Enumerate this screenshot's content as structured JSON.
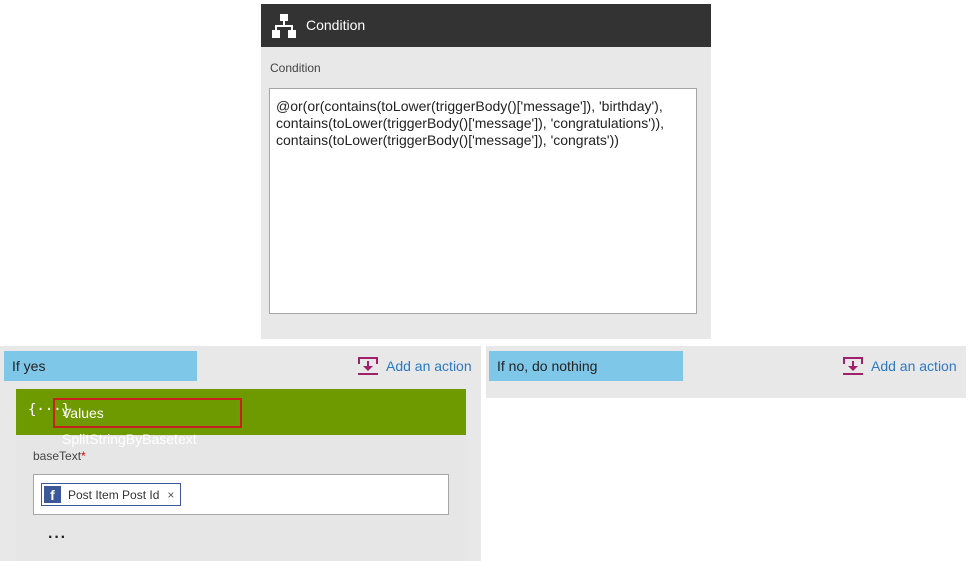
{
  "condition": {
    "header_title": "Condition",
    "field_label": "Condition",
    "expression_lines": [
      "@or(or(contains(toLower(triggerBody()['message']), 'birthday'),",
      "contains(toLower(triggerBody()['message']), 'congratulations')),",
      "contains(toLower(triggerBody()['message']), 'congrats'))"
    ]
  },
  "yes_branch": {
    "label": "If yes",
    "add_action": "Add an action",
    "action": {
      "icon": "{···}",
      "title": "Values SplitStringByBasetext",
      "field_label": "baseText",
      "required_mark": "*",
      "token_label": "Post Item Post Id",
      "token_remove": "×",
      "token_icon": "f",
      "more": "···"
    }
  },
  "no_branch": {
    "label": "If no, do nothing",
    "add_action": "Add an action"
  },
  "colors": {
    "header_dark": "#333333",
    "action_green": "#6e9a00",
    "branch_blue": "#7fc7e8",
    "link_blue": "#2b78c5",
    "add_icon_magenta": "#a0206a",
    "highlight_red": "#c8201d",
    "facebook_blue": "#3b5998"
  }
}
